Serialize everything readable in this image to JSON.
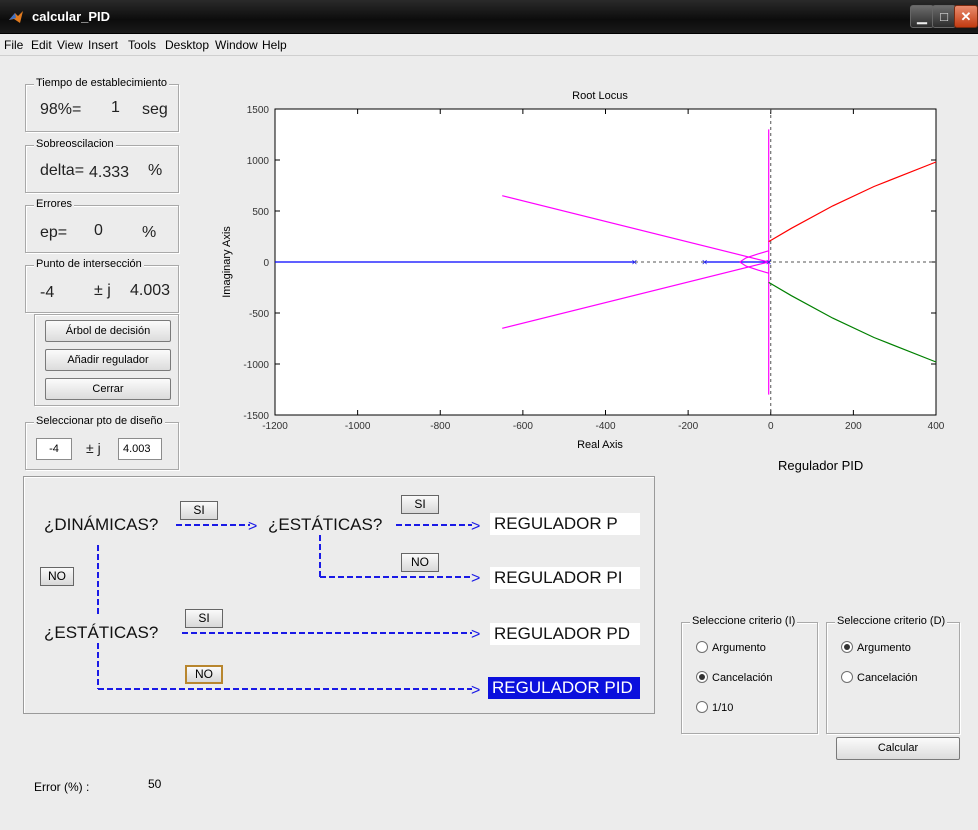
{
  "window": {
    "title": "calcular_PID"
  },
  "menu": [
    "File",
    "Edit",
    "View",
    "Insert",
    "Tools",
    "Desktop",
    "Window",
    "Help"
  ],
  "tiempo": {
    "title": "Tiempo de establecimiento",
    "label": "98%=",
    "value": "1",
    "unit": "seg"
  },
  "sobre": {
    "title": "Sobreoscilacion",
    "label": "delta=",
    "value": "4.333",
    "unit": "%"
  },
  "errores": {
    "title": "Errores",
    "label": "ep=",
    "value": "0",
    "unit": "%"
  },
  "punto": {
    "title": "Punto de intersección",
    "real": "-4",
    "pm": "± j",
    "imag": "4.003"
  },
  "buttons": {
    "arbol": "Árbol de decisión",
    "anadir": "Añadir regulador",
    "cerrar": "Cerrar",
    "calcular": "Calcular"
  },
  "seleccionar": {
    "title": "Seleccionar pto de diseño",
    "real": "-4",
    "pm": "± j",
    "imag": "4.003"
  },
  "plot": {
    "title": "Root Locus",
    "xlabel": "Real Axis",
    "ylabel": "Imaginary Axis",
    "xticks": [
      "-1200",
      "-1000",
      "-800",
      "-600",
      "-400",
      "-200",
      "0",
      "200",
      "400"
    ],
    "yticks": [
      "1500",
      "1000",
      "500",
      "0",
      "-500",
      "-1000",
      "-1500"
    ]
  },
  "regulador_label": "Regulador PID",
  "decision": {
    "dinamicas": "¿DINÁMICAS?",
    "estaticas1": "¿ESTÁTICAS?",
    "estaticas2": "¿ESTÁTICAS?",
    "si": "SI",
    "no": "NO",
    "reg_p": "REGULADOR P",
    "reg_pi": "REGULADOR PI",
    "reg_pd": "REGULADOR PD",
    "reg_pid": "REGULADOR PID"
  },
  "criterio_i": {
    "title": "Seleccione criterio (I)",
    "options": [
      "Argumento",
      "Cancelación",
      "1/10"
    ],
    "selected": "Cancelación"
  },
  "criterio_d": {
    "title": "Seleccione criterio (D)",
    "options": [
      "Argumento",
      "Cancelación"
    ],
    "selected": "Argumento"
  },
  "error": {
    "label": "Error (%) :",
    "value": "50"
  },
  "chart_data": {
    "type": "line",
    "title": "Root Locus",
    "xlabel": "Real Axis",
    "ylabel": "Imaginary Axis",
    "xlim": [
      -1200,
      400
    ],
    "ylim": [
      -1500,
      1500
    ],
    "grid": false,
    "series": [
      {
        "color": "#0000ff",
        "x": [
          -1200,
          -330
        ],
        "y": [
          0,
          0
        ]
      },
      {
        "color": "#0000ff",
        "x": [
          -160,
          -5
        ],
        "y": [
          0,
          0
        ]
      },
      {
        "color": "#ff00ff",
        "x": [
          -650,
          -5
        ],
        "y": [
          650,
          0
        ]
      },
      {
        "color": "#ff00ff",
        "x": [
          -650,
          -5
        ],
        "y": [
          -650,
          0
        ]
      },
      {
        "color": "#ff00ff",
        "x": [
          -5,
          -5
        ],
        "y": [
          -1300,
          1300
        ]
      },
      {
        "color": "#ff00ff",
        "x": [
          -75,
          -60,
          -30,
          -5
        ],
        "y": [
          0,
          40,
          80,
          110
        ]
      },
      {
        "color": "#ff00ff",
        "x": [
          -75,
          -60,
          -30,
          -5
        ],
        "y": [
          0,
          -40,
          -80,
          -110
        ]
      },
      {
        "color": "#ff0000",
        "x": [
          -5,
          50,
          150,
          250,
          400
        ],
        "y": [
          200,
          330,
          550,
          740,
          980
        ]
      },
      {
        "color": "#008000",
        "x": [
          -5,
          50,
          150,
          250,
          400
        ],
        "y": [
          -200,
          -330,
          -550,
          -740,
          -980
        ]
      }
    ],
    "poles": [
      [
        -330,
        0
      ],
      [
        -160,
        0
      ],
      [
        -5,
        0
      ]
    ]
  }
}
